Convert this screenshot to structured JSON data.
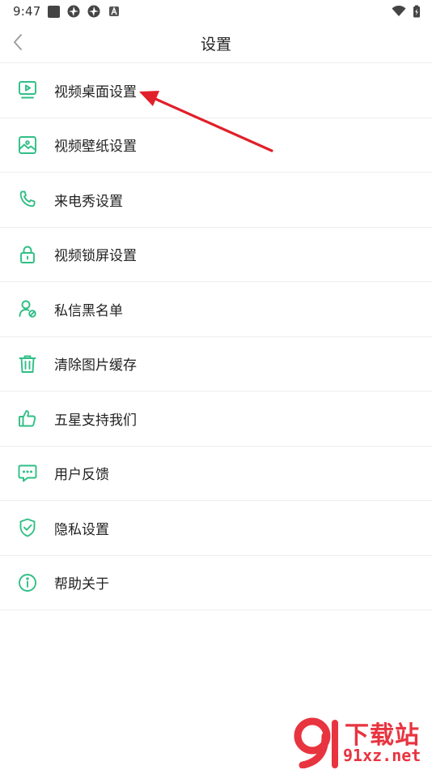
{
  "status_bar": {
    "time": "9:47"
  },
  "header": {
    "title": "设置"
  },
  "settings_items": [
    {
      "label": "视频桌面设置",
      "icon": "video-desktop-icon"
    },
    {
      "label": "视频壁纸设置",
      "icon": "wallpaper-icon"
    },
    {
      "label": "来电秀设置",
      "icon": "phone-icon"
    },
    {
      "label": "视频锁屏设置",
      "icon": "lock-icon"
    },
    {
      "label": "私信黑名单",
      "icon": "user-block-icon"
    },
    {
      "label": "清除图片缓存",
      "icon": "trash-icon"
    },
    {
      "label": "五星支持我们",
      "icon": "thumbs-up-icon"
    },
    {
      "label": "用户反馈",
      "icon": "chat-bubble-icon"
    },
    {
      "label": "隐私设置",
      "icon": "shield-check-icon"
    },
    {
      "label": "帮助关于",
      "icon": "info-icon"
    }
  ],
  "watermark": {
    "top": "下载站",
    "bottom": "91xz.net"
  },
  "colors": {
    "accent": "#2fbf85",
    "annotation": "#e0202a",
    "divider": "#eeeeee"
  }
}
